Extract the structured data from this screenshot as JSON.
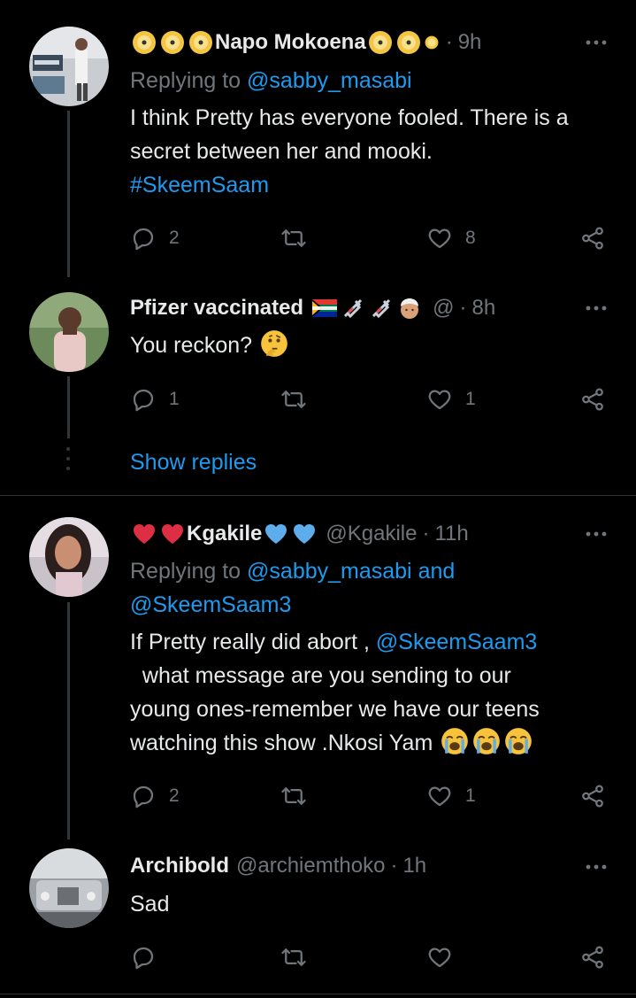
{
  "tweets": [
    {
      "name": "Napo Mokoena",
      "handle": "",
      "time": "9h",
      "replying_label": "Replying to",
      "replying_to": "@sabby_masabi",
      "text": "I think Pretty has everyone fooled. There is a secret between her and mooki.",
      "hashtag": "#SkeemSaam",
      "replies": "2",
      "retweets": "",
      "likes": "8"
    },
    {
      "name": "Pfizer vaccinated",
      "handle": "@",
      "time": "8h",
      "text": "You reckon?",
      "replies": "1",
      "retweets": "",
      "likes": "1"
    },
    {
      "name": "Kgakile",
      "handle": "@Kgakile",
      "time": "11h",
      "replying_label": "Replying to",
      "replying_to": "@sabby_masabi",
      "replying_and": "and",
      "replying_to_2": "@SkeemSaam3",
      "text_1": "If Pretty really did abort ,",
      "mention": "@SkeemSaam3",
      "text_2": "what message are you  sending to our",
      "text_3": "young ones-remember we have our teens",
      "text_4": "watching this show  .Nkosi Yam",
      "replies": "2",
      "retweets": "",
      "likes": "1"
    },
    {
      "name": "Archibold",
      "handle": "@archiemthoko",
      "time": "1h",
      "text": "Sad",
      "replies": "",
      "retweets": "",
      "likes": ""
    }
  ],
  "show_replies": "Show replies",
  "separator": "·",
  "colors": {
    "background": "#000000",
    "text": "#e7e9ea",
    "muted": "#71767b",
    "link": "#1d9bf0",
    "divider": "#2f3336"
  },
  "icons": [
    "reply-icon",
    "retweet-icon",
    "like-icon",
    "share-icon",
    "more-icon"
  ]
}
